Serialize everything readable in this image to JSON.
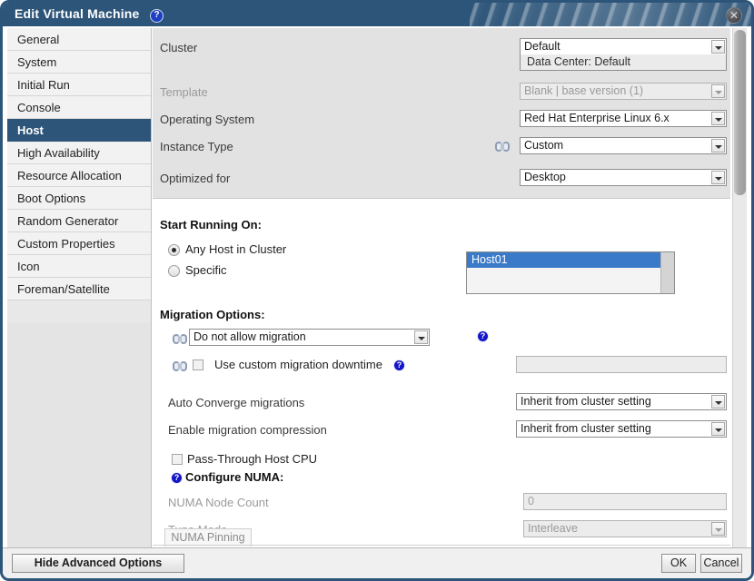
{
  "window": {
    "title": "Edit Virtual Machine",
    "title_help_icon": "help-question-icon",
    "title_help_glyph": "?",
    "close_icon": "close-x-icon",
    "close_glyph": "✕",
    "accent_color": "#2d5579",
    "selection_color": "#3a7ac8",
    "help_badge_color": "#1414c8"
  },
  "sidebar": {
    "items": [
      {
        "label": "General",
        "selected": false
      },
      {
        "label": "System",
        "selected": false
      },
      {
        "label": "Initial Run",
        "selected": false
      },
      {
        "label": "Console",
        "selected": false
      },
      {
        "label": "Host",
        "selected": true
      },
      {
        "label": "High Availability",
        "selected": false
      },
      {
        "label": "Resource Allocation",
        "selected": false
      },
      {
        "label": "Boot Options",
        "selected": false
      },
      {
        "label": "Random Generator",
        "selected": false
      },
      {
        "label": "Custom Properties",
        "selected": false
      },
      {
        "label": "Icon",
        "selected": false
      },
      {
        "label": "Foreman/Satellite",
        "selected": false
      }
    ]
  },
  "top_panel": {
    "cluster": {
      "label": "Cluster",
      "value": "Default",
      "sub_value": "Data Center: Default"
    },
    "template": {
      "label": "Template",
      "value": "Blank | base version (1)",
      "disabled": true
    },
    "operating_system": {
      "label": "Operating System",
      "value": "Red Hat Enterprise Linux 6.x"
    },
    "instance_type": {
      "label": "Instance Type",
      "value": "Custom",
      "link_icon": "broken-chain-link-icon"
    },
    "optimized_for": {
      "label": "Optimized for",
      "value": "Desktop"
    }
  },
  "start_running_on": {
    "heading": "Start Running On:",
    "radio_any": {
      "label": "Any Host in Cluster",
      "checked": true
    },
    "radio_specific": {
      "label": "Specific",
      "checked": false
    },
    "host_list": {
      "items": [
        {
          "label": "Host01",
          "selected": true
        }
      ]
    }
  },
  "migration_options": {
    "heading": "Migration Options:",
    "migration_mode": {
      "value": "Do not allow migration",
      "link_icon": "broken-chain-link-icon",
      "help_icon": "help-question-icon",
      "help_glyph": "?"
    },
    "custom_downtime": {
      "label": "Use custom migration downtime",
      "checked": false,
      "link_icon": "broken-chain-link-icon",
      "help_icon": "help-question-icon",
      "help_glyph": "?",
      "input_value": "",
      "input_disabled": true
    },
    "auto_converge": {
      "label": "Auto Converge migrations",
      "value": "Inherit from cluster setting"
    },
    "migration_compression": {
      "label": "Enable migration compression",
      "value": "Inherit from cluster setting"
    }
  },
  "cpu_numa": {
    "pass_through": {
      "label": "Pass-Through Host CPU",
      "checked": false
    },
    "configure_numa": {
      "label": "Configure NUMA:",
      "help_icon": "help-question-icon",
      "help_glyph": "?"
    },
    "numa_node_count": {
      "label": "NUMA Node Count",
      "value": "0",
      "disabled": true
    },
    "tune_mode": {
      "label": "Tune Mode",
      "value": "Interleave",
      "disabled": true
    },
    "numa_pinning_button": {
      "label": "NUMA Pinning",
      "disabled": true
    }
  },
  "footer": {
    "hide_advanced": "Hide Advanced Options",
    "ok": "OK",
    "cancel": "Cancel"
  }
}
